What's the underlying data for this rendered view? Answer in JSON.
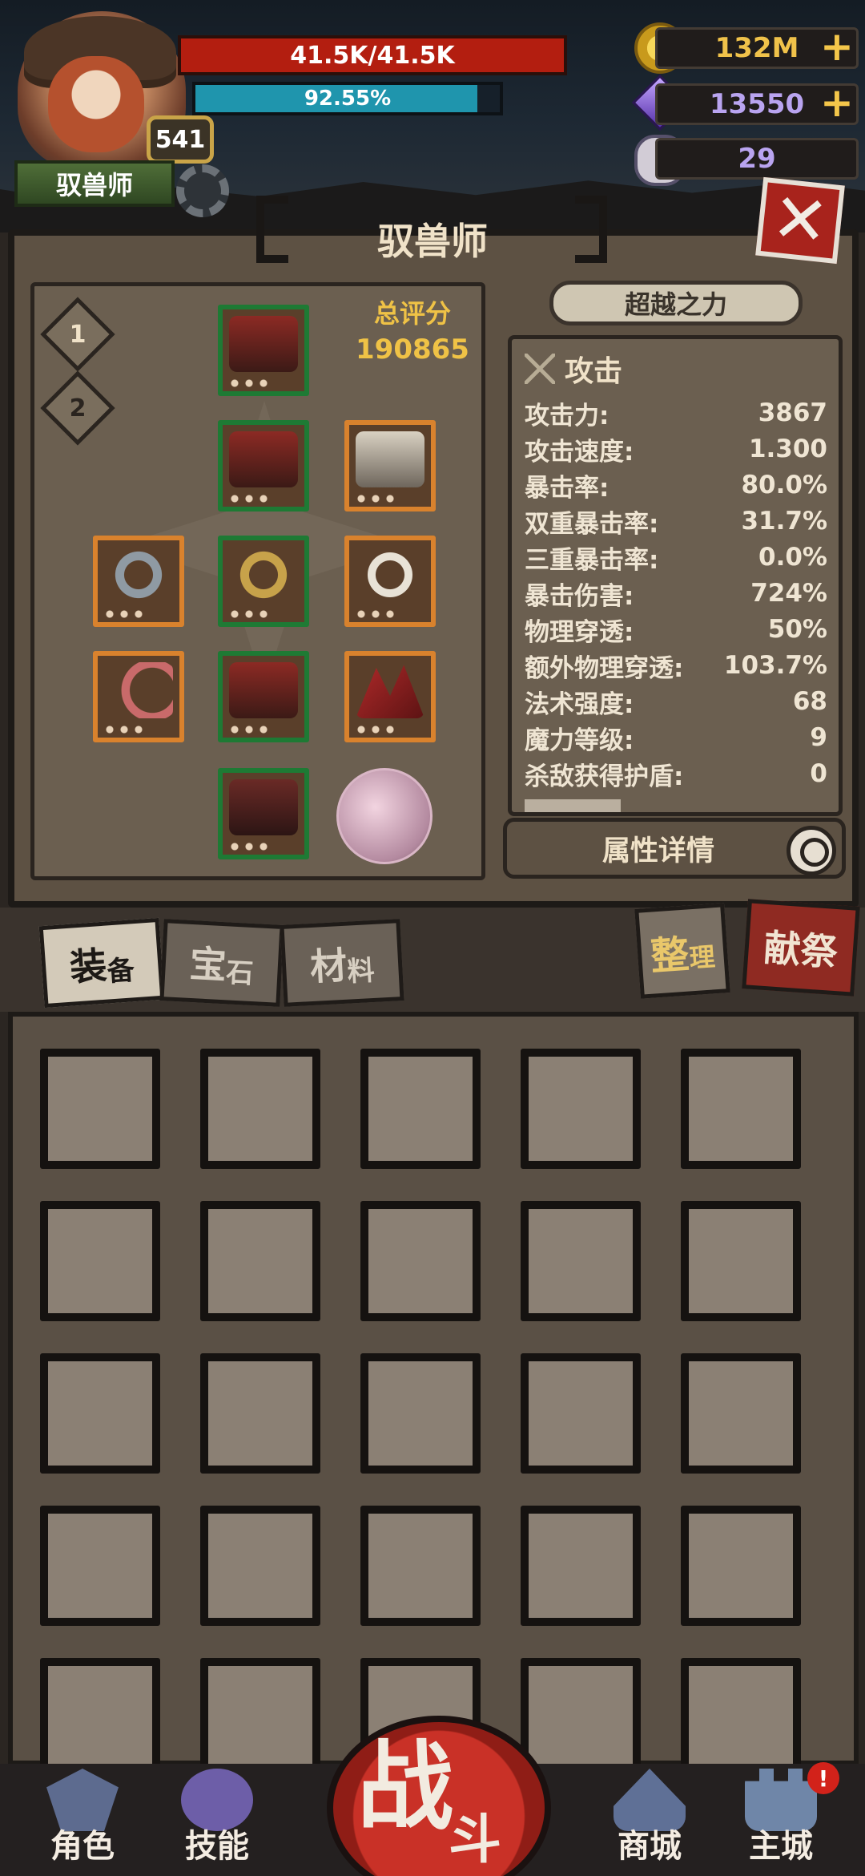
{
  "player": {
    "class_name": "驭兽师",
    "level": "541",
    "hp_text": "41.5K/41.5K",
    "mp_text": "92.55%",
    "mp_fraction": 0.9255
  },
  "resources": {
    "gold": "132M",
    "crystals": "13550",
    "skulls": "29"
  },
  "panel": {
    "title": "驭兽师",
    "score_label": "总评分",
    "score_value": "190865",
    "loadouts": [
      "1",
      "2"
    ],
    "beyond_label": "超越之力",
    "detail_label": "属性详情"
  },
  "stats": {
    "header": "攻击",
    "rows": [
      {
        "name": "攻击力:",
        "value": "3867"
      },
      {
        "name": "攻击速度:",
        "value": "1.300"
      },
      {
        "name": "暴击率:",
        "value": "80.0%"
      },
      {
        "name": "双重暴击率:",
        "value": "31.7%"
      },
      {
        "name": "三重暴击率:",
        "value": "0.0%"
      },
      {
        "name": "暴击伤害:",
        "value": "724%"
      },
      {
        "name": "物理穿透:",
        "value": "50%"
      },
      {
        "name": "额外物理穿透:",
        "value": "103.7%"
      },
      {
        "name": "法术强度:",
        "value": "68"
      },
      {
        "name": "魔力等级:",
        "value": "9"
      },
      {
        "name": "杀敌获得护盾:",
        "value": "0"
      }
    ]
  },
  "tabs": {
    "equipment": {
      "big": "装",
      "small": "备"
    },
    "gems": {
      "big": "宝",
      "small": "石"
    },
    "materials": {
      "big": "材",
      "small": "料"
    },
    "sort": {
      "big": "整",
      "small": "理"
    },
    "sacrifice": "献祭"
  },
  "nav": {
    "role": "角色",
    "skill": "技能",
    "battle_big": "战",
    "battle_small": "斗",
    "shop": "商城",
    "main_city": "主城",
    "alert": "!"
  },
  "colors": {
    "hp": "#b31e10",
    "mp": "#1f95ad",
    "gold_text": "#f0c24a",
    "crystal_text": "#b9a4f0",
    "skull_text": "#b9a4f0",
    "score": "#efc246"
  }
}
